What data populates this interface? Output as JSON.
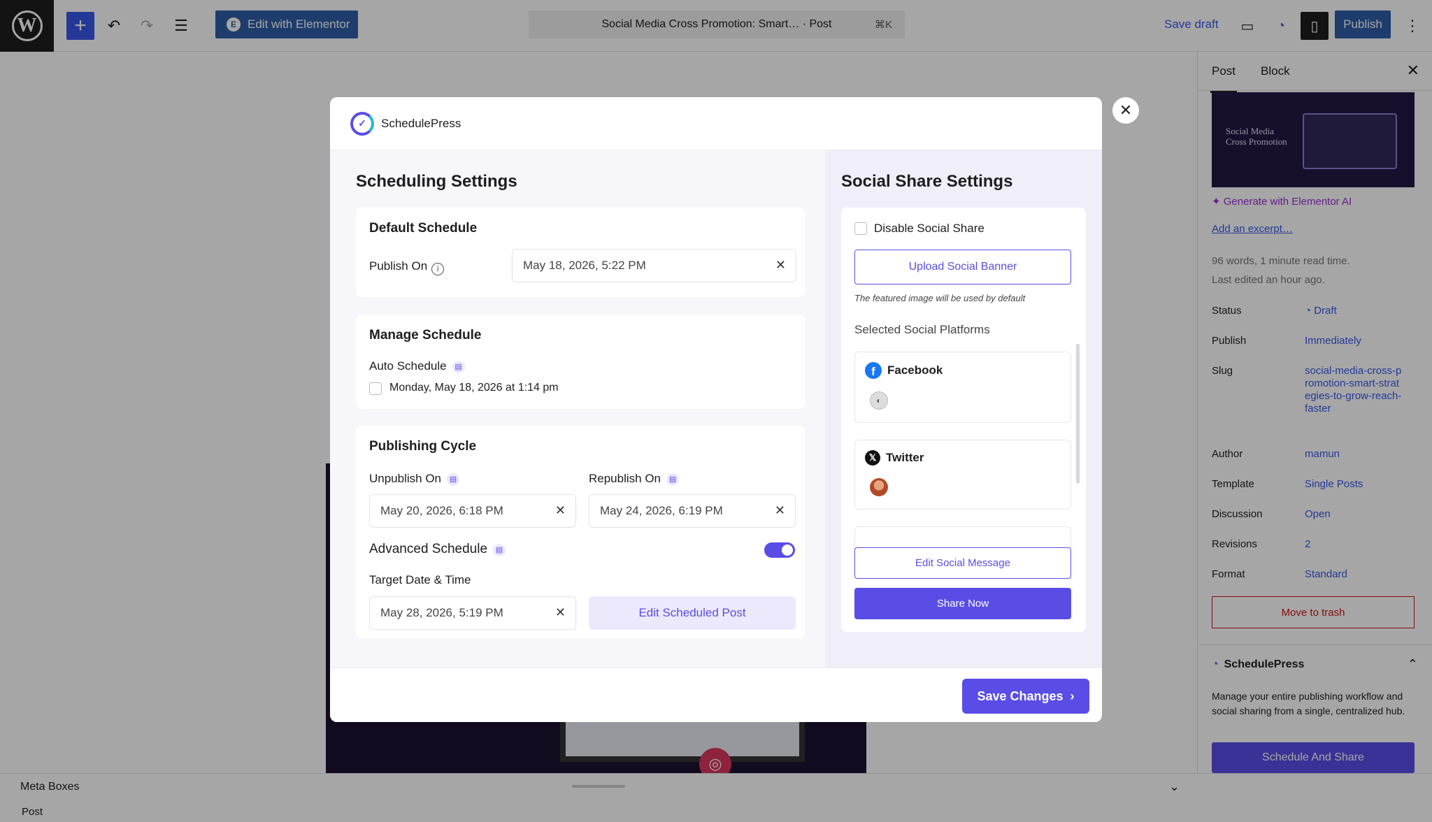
{
  "topbar": {
    "wp_logo": "W",
    "edit_elementor": "Edit with Elementor",
    "doc_title": "Social Media Cross Promotion: Smart… · Post",
    "shortcut": "⌘K",
    "save_draft": "Save draft",
    "publish": "Publish"
  },
  "sidebar": {
    "tab_post": "Post",
    "tab_block": "Block",
    "featured_text": "Social Media Cross Promotion",
    "generate_ai": "Generate with Elementor AI",
    "add_excerpt": "Add an excerpt…",
    "word_count": "96 words, 1 minute read time.",
    "last_edited": "Last edited an hour ago.",
    "rows": [
      {
        "label": "Status",
        "value": "Draft"
      },
      {
        "label": "Publish",
        "value": "Immediately"
      },
      {
        "label": "Slug",
        "value": "social-media-cross-promotion-smart-strategies-to-grow-reach-faster"
      },
      {
        "label": "Author",
        "value": "mamun"
      },
      {
        "label": "Template",
        "value": "Single Posts"
      },
      {
        "label": "Discussion",
        "value": "Open"
      },
      {
        "label": "Revisions",
        "value": "2"
      },
      {
        "label": "Format",
        "value": "Standard"
      }
    ],
    "move_to_trash": "Move to trash",
    "sp_title": "SchedulePress",
    "sp_desc": "Manage your entire publishing workflow and social sharing from a single, centralized hub.",
    "schedule_and_share": "Schedule And Share"
  },
  "footer": {
    "meta_boxes": "Meta Boxes",
    "breadcrumb": "Post"
  },
  "modal": {
    "brand": "SchedulePress",
    "scheduling_title": "Scheduling Settings",
    "default_schedule": {
      "title": "Default Schedule",
      "publish_on_label": "Publish On",
      "publish_on_value": "May 18, 2026, 5:22 PM"
    },
    "manage_schedule": {
      "title": "Manage Schedule",
      "auto_schedule_label": "Auto Schedule",
      "auto_schedule_option": "Monday, May 18, 2026 at 1:14 pm"
    },
    "publishing_cycle": {
      "title": "Publishing Cycle",
      "unpublish_label": "Unpublish On",
      "unpublish_value": "May 20, 2026, 6:18 PM",
      "republish_label": "Republish On",
      "republish_value": "May 24, 2026, 6:19 PM",
      "advanced_label": "Advanced Schedule",
      "advanced_enabled": true,
      "target_label": "Target Date & Time",
      "target_value": "May 28, 2026, 5:19 PM",
      "edit_scheduled": "Edit Scheduled Post"
    },
    "social_title": "Social Share Settings",
    "social": {
      "disable_label": "Disable Social Share",
      "upload_banner": "Upload Social Banner",
      "hint": "The featured image will be used by default",
      "selected_title": "Selected Social Platforms",
      "platforms": [
        {
          "name": "Facebook",
          "icon": "facebook-icon"
        },
        {
          "name": "Twitter",
          "icon": "x-twitter-icon"
        }
      ],
      "edit_message": "Edit Social Message",
      "share_now": "Share Now"
    },
    "save_changes": "Save Changes"
  },
  "colors": {
    "accent": "#5a4de6",
    "wp_blue": "#3858e9",
    "danger": "#cc1818"
  }
}
